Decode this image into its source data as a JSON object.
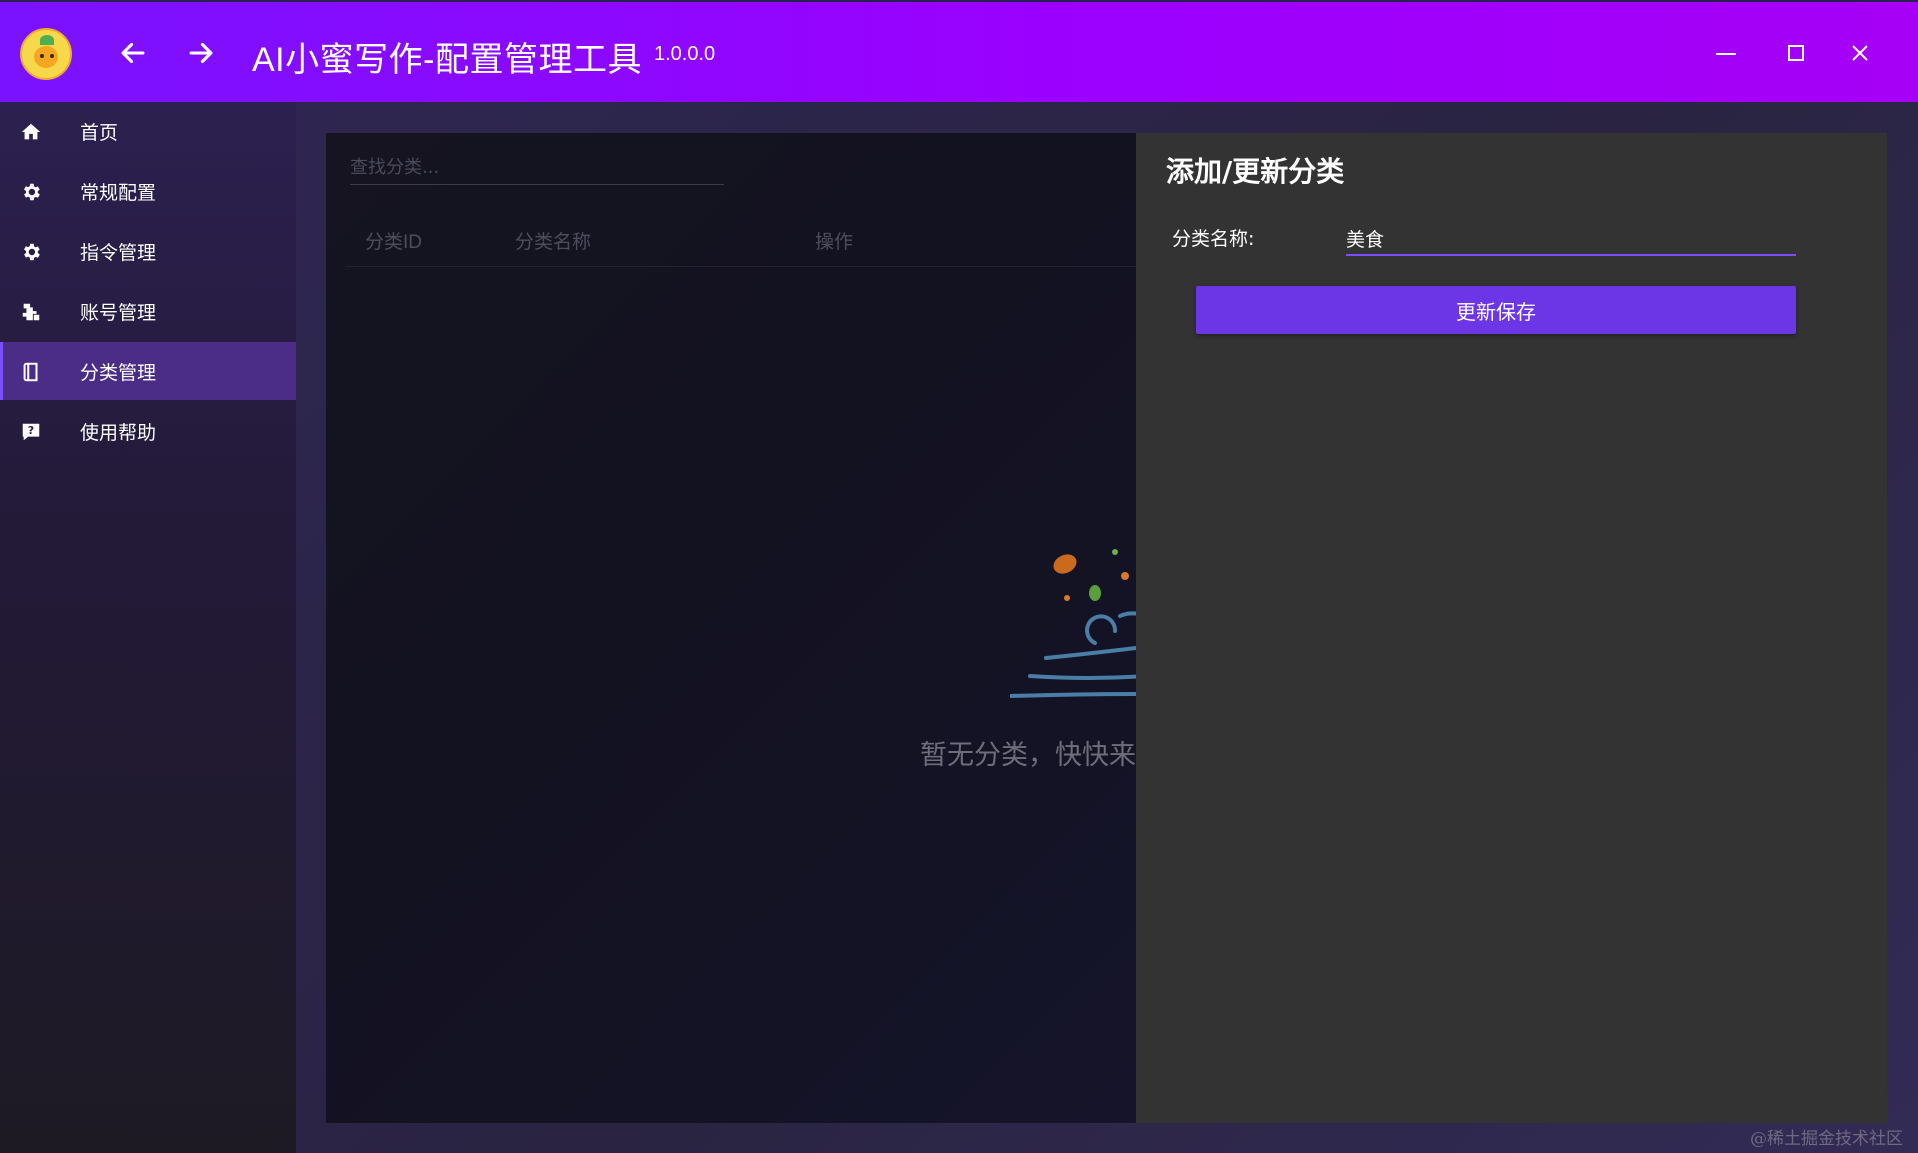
{
  "window": {
    "title": "AI小蜜写作-配置管理工具",
    "version": "1.0.0.0",
    "logo_icon": "pineapple-mascot-icon",
    "controls": [
      "back-arrow-icon",
      "forward-arrow-icon",
      "minimize-icon",
      "maximize-icon",
      "close-icon"
    ]
  },
  "sidebar": {
    "items": [
      {
        "label": "首页",
        "icon": "home-icon",
        "active": false
      },
      {
        "label": "常规配置",
        "icon": "gear-icon",
        "active": false
      },
      {
        "label": "指令管理",
        "icon": "gear-icon",
        "active": false
      },
      {
        "label": "账号管理",
        "icon": "account-icon",
        "active": false
      },
      {
        "label": "分类管理",
        "icon": "book-icon",
        "active": true
      },
      {
        "label": "使用帮助",
        "icon": "help-icon",
        "active": false
      }
    ]
  },
  "category_list": {
    "search_placeholder": "查找分类...",
    "columns": [
      "分类ID",
      "分类名称",
      "操作"
    ],
    "empty_text": "暂无分类，快快来",
    "empty_icon": "wind-leaves-empty-icon"
  },
  "edit_panel": {
    "title": "添加/更新分类",
    "name_label": "分类名称:",
    "name_value": "美食",
    "save_button": "更新保存"
  },
  "watermark": "@稀土掘金技术社区",
  "colors": {
    "titlebar_start": "#7a12ff",
    "titlebar_end": "#a600f6",
    "accent": "#7c4dff",
    "button": "#6c35e6",
    "sidebar_active": "#4b2d87",
    "edit_panel_bg": "#333333"
  }
}
